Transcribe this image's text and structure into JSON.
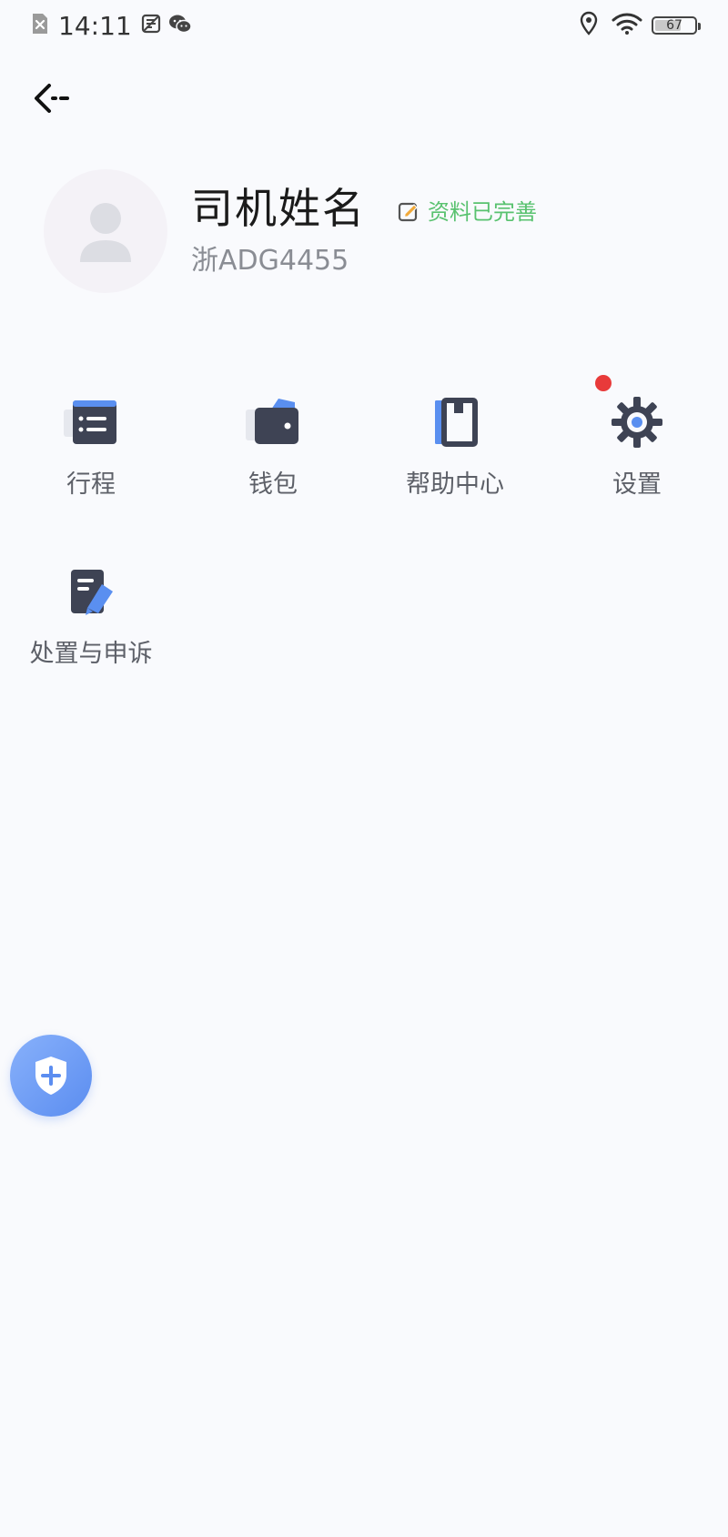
{
  "status_bar": {
    "time": "14:11",
    "battery_level": "67",
    "icons": [
      "sim-missing-icon",
      "weibo-icon",
      "wechat-icon",
      "location-icon",
      "wifi-icon",
      "battery-icon"
    ]
  },
  "nav": {
    "back_icon": "back-arrow-icon"
  },
  "profile": {
    "name": "司机姓名",
    "status": "资料已完善",
    "plate": "浙ADG4455",
    "avatar_icon": "avatar-placeholder-icon"
  },
  "menu": {
    "items": [
      {
        "label": "行程",
        "icon": "trip-list-icon"
      },
      {
        "label": "钱包",
        "icon": "wallet-icon"
      },
      {
        "label": "帮助中心",
        "icon": "help-book-icon"
      },
      {
        "label": "设置",
        "icon": "gear-icon",
        "badge": true
      },
      {
        "label": "处置与申诉",
        "icon": "appeal-document-icon"
      }
    ]
  },
  "floating": {
    "icon": "shield-plus-icon"
  },
  "colors": {
    "background": "#f9fafd",
    "icon_dark": "#3e4354",
    "icon_blue": "#5a8ff0",
    "status_green": "#59c26f",
    "badge_red": "#e83a3a",
    "label_gray": "#5d6068"
  }
}
